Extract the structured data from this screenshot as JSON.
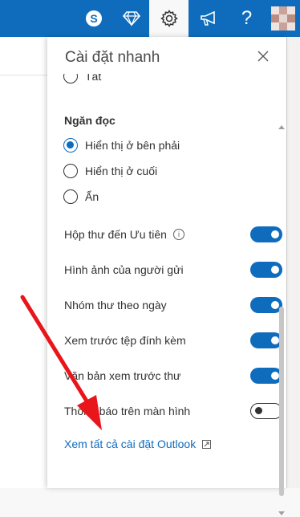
{
  "topbar": {
    "icons": [
      "skype-icon",
      "diamond-icon",
      "gear-icon",
      "megaphone-icon",
      "help-icon",
      "avatar"
    ],
    "help_glyph": "?",
    "accent": "#0f6cbd"
  },
  "panel": {
    "title": "Cài đặt nhanh",
    "partial_option": "Tắt",
    "reading_pane": {
      "label": "Ngăn đọc",
      "options": [
        {
          "label": "Hiển thị ở bên phải",
          "checked": true
        },
        {
          "label": "Hiển thị ở cuối",
          "checked": false
        },
        {
          "label": "Ẩn",
          "checked": false
        }
      ]
    },
    "toggles": [
      {
        "label": "Hộp thư đến Ưu tiên",
        "on": true,
        "info": true
      },
      {
        "label": "Hình ảnh của người gửi",
        "on": true
      },
      {
        "label": "Nhóm thư theo ngày",
        "on": true
      },
      {
        "label": "Xem trước tệp đính kèm",
        "on": true
      },
      {
        "label": "Văn bản xem trước thư",
        "on": true
      },
      {
        "label": "Thông báo trên màn hình",
        "on": false
      }
    ],
    "info_glyph": "i",
    "link": "Xem tất cả cài đặt Outlook"
  },
  "annotation": {
    "arrow_color": "#e8151b"
  }
}
